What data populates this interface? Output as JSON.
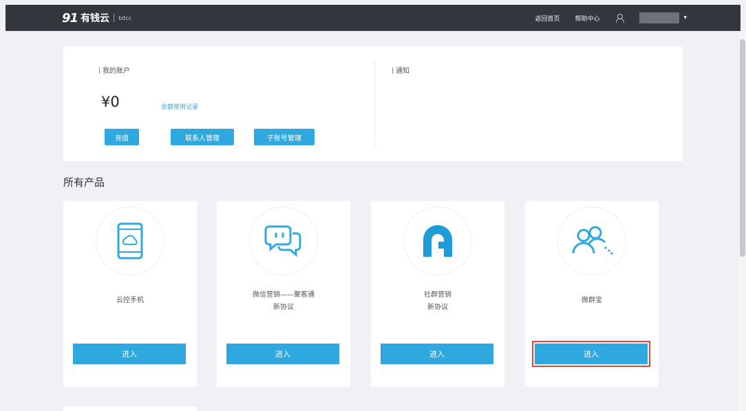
{
  "header": {
    "logo_mark": "91",
    "logo_name": "有钱云",
    "logo_sub": "bitcc",
    "links": [
      "返回首页",
      "帮助中心"
    ],
    "user_caret": "▾"
  },
  "account": {
    "section_label": "我的账户",
    "balance": "¥0",
    "balance_link": "余额使用记录",
    "buttons": [
      "充值",
      "联系人管理",
      "子账号管理"
    ]
  },
  "notice": {
    "section_label": "通知"
  },
  "products": {
    "heading": "所有产品",
    "items": [
      {
        "icon": "cloud-phone-icon",
        "title": "云控手机",
        "subtitle": "",
        "button": "进入"
      },
      {
        "icon": "chat-bubbles-icon",
        "title": "微信营销——聚客通",
        "subtitle": "新协议",
        "button": "进入"
      },
      {
        "icon": "g-logo-icon",
        "title": "社群营销",
        "subtitle": "新协议",
        "button": "进入"
      },
      {
        "icon": "users-icon",
        "title": "微群宝",
        "subtitle": "",
        "button": "进入"
      }
    ]
  },
  "colors": {
    "accent": "#2fa8e0",
    "topbar": "#33373d",
    "highlight": "#e2473b",
    "background": "#eff1f5"
  }
}
